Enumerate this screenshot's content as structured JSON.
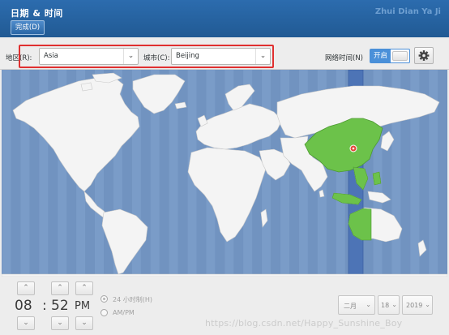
{
  "header": {
    "title": "日期 & 时间",
    "right_text": "Zhui Dian Ya Ji",
    "done_label": "完成(D)"
  },
  "toolbar": {
    "region_label": "地区(R):",
    "region_value": "Asia",
    "city_label": "城市(C):",
    "city_value": "Beijing",
    "network_time_label": "网络时间(N)",
    "network_time_state": "开启",
    "network_time_on": true,
    "settings_icon": "gear-icon"
  },
  "time": {
    "hour": "08",
    "separator": ":",
    "minute": "52",
    "ampm": "PM",
    "format_24h_label": "24 小时制(H)",
    "format_ampm_label": "AM/PM",
    "up_icon": "chevron-up-icon",
    "down_icon": "chevron-down-icon"
  },
  "date": {
    "month": "二月",
    "day": "18",
    "year": "2019"
  },
  "watermark": "https://blog.csdn.net/Happy_Sunshine_Boy",
  "colors": {
    "header_bg": "#215a94",
    "ocean": "#7a9cc8",
    "land": "#f4f4f4",
    "selected_country": "#6cc24a",
    "selected_timezone": "#5a82c2",
    "accent": "#4a90d9",
    "highlight_box": "#e03030"
  }
}
